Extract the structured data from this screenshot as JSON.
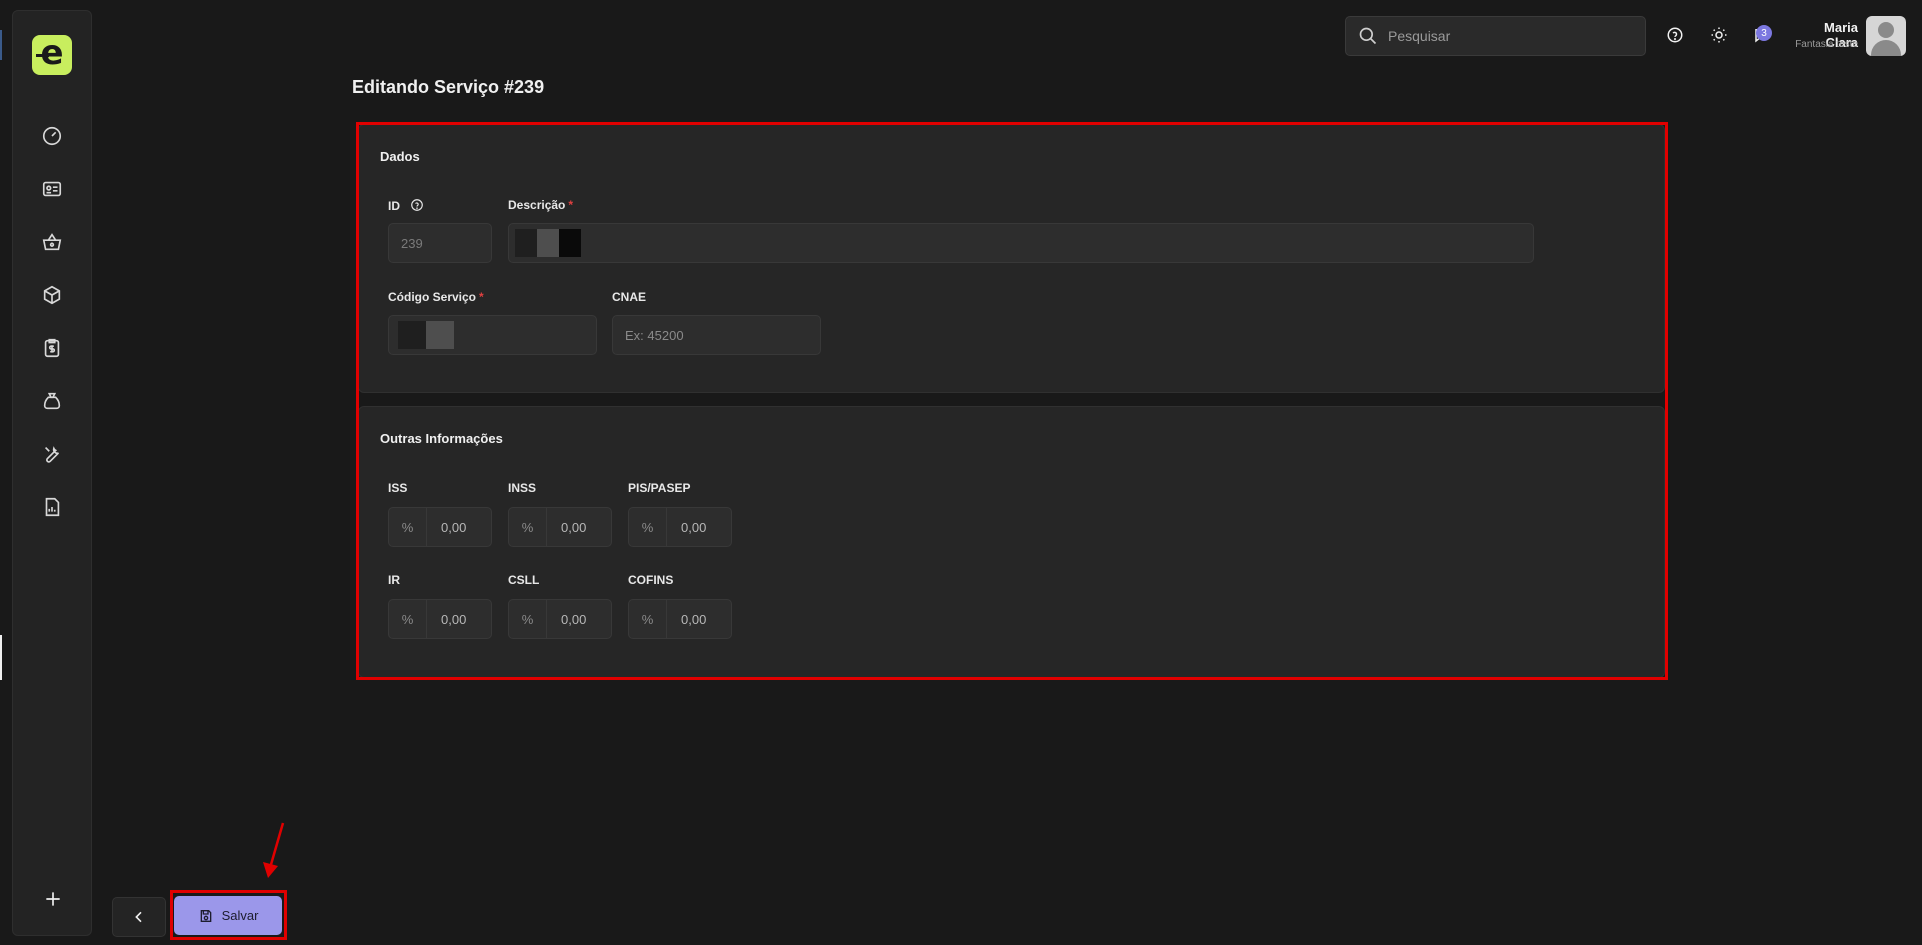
{
  "search": {
    "placeholder": "Pesquisar"
  },
  "user": {
    "name": "Maria Clara",
    "company": "Fantasia teste",
    "notification_count": "3"
  },
  "page": {
    "title": "Editando Serviço #239"
  },
  "dados": {
    "title": "Dados",
    "id_label": "ID",
    "id_value": "239",
    "descricao_label": "Descrição",
    "codigo_label": "Código Serviço",
    "cnae_label": "CNAE",
    "cnae_placeholder": "Ex: 45200",
    "required_mark": "*"
  },
  "outras": {
    "title": "Outras Informações",
    "prefix": "%",
    "fields": [
      {
        "label": "ISS",
        "value": "0,00"
      },
      {
        "label": "INSS",
        "value": "0,00"
      },
      {
        "label": "PIS/PASEP",
        "value": "0,00"
      },
      {
        "label": "IR",
        "value": "0,00"
      },
      {
        "label": "CSLL",
        "value": "0,00"
      },
      {
        "label": "COFINS",
        "value": "0,00"
      }
    ]
  },
  "actions": {
    "save_label": "Salvar"
  },
  "sidebar": {
    "logo_letter": "e",
    "items": [
      "dashboard-icon",
      "id-card-icon",
      "basket-icon",
      "box-icon",
      "clipboard-dollar-icon",
      "money-bag-icon",
      "wrench-icon",
      "report-icon"
    ]
  },
  "colors": {
    "accent": "#9b97ea",
    "logo": "#c8ee5e",
    "highlight": "#e00000"
  }
}
